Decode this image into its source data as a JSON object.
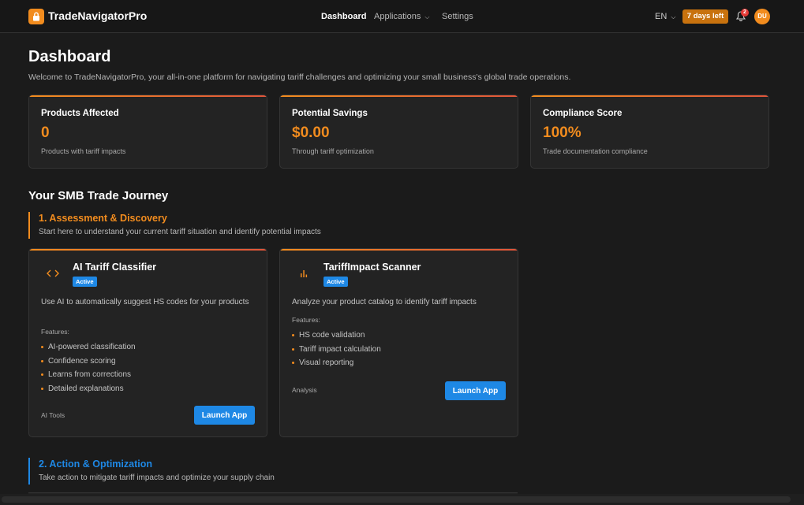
{
  "header": {
    "brand": "TradeNavigatorPro",
    "nav": [
      {
        "label": "Dashboard"
      },
      {
        "label": "Applications"
      },
      {
        "label": "Settings"
      }
    ],
    "language": "EN",
    "trial_badge": "7 days left",
    "notification_count": "2",
    "avatar_initials": "DU"
  },
  "page": {
    "title": "Dashboard",
    "subtitle": "Welcome to TradeNavigatorPro, your all-in-one platform for navigating tariff challenges and optimizing your small business's global trade operations."
  },
  "stats": [
    {
      "label": "Products Affected",
      "value": "0",
      "desc": "Products with tariff impacts"
    },
    {
      "label": "Potential Savings",
      "value": "$0.00",
      "desc": "Through tariff optimization"
    },
    {
      "label": "Compliance Score",
      "value": "100%",
      "desc": "Trade documentation compliance"
    }
  ],
  "journey": {
    "title": "Your SMB Trade Journey",
    "sections": [
      {
        "heading": "1. Assessment & Discovery",
        "sub": "Start here to understand your current tariff situation and identify potential impacts",
        "color": "#f28c1e"
      },
      {
        "heading": "2. Action & Optimization",
        "sub": "Take action to mitigate tariff impacts and optimize your supply chain",
        "color": "#1e88e5"
      }
    ]
  },
  "cards": [
    {
      "title": "AI Tariff Classifier",
      "icon": "code-icon",
      "status": "Active",
      "desc": "Use AI to automatically suggest HS codes for your products",
      "features_label": "Features:",
      "features": [
        "AI-powered classification",
        "Confidence scoring",
        "Learns from corrections",
        "Detailed explanations"
      ],
      "category": "AI Tools",
      "button": "Launch App"
    },
    {
      "title": "TariffImpact Scanner",
      "icon": "bar-chart-icon",
      "status": "Active",
      "desc": "Analyze your product catalog to identify tariff impacts",
      "features_label": "Features:",
      "features": [
        "HS code validation",
        "Tariff impact calculation",
        "Visual reporting"
      ],
      "category": "Analysis",
      "button": "Launch App"
    }
  ],
  "colors": {
    "accent": "#f28c1e",
    "primary": "#1e88e5",
    "background": "#1b1b1b",
    "card": "#232323"
  }
}
